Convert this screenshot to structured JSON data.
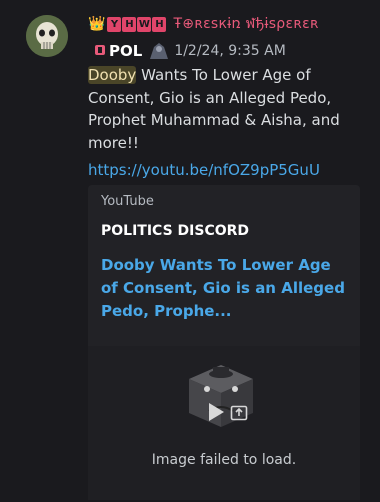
{
  "message": {
    "author": {
      "crown_icon": "crown-icon",
      "tag_letters": [
        "Y",
        "H",
        "W",
        "H"
      ],
      "tag_color": "#e0456a",
      "name": "Ŧ⊕ʀɛѕкɨռ ฬђɨѕρɛʀɛʀ",
      "name_color": "#e85a7a"
    },
    "role_tag": "POL",
    "timestamp": "1/2/24, 9:35 AM",
    "text": {
      "mention": "Dooby",
      "body": " Wants To Lower Age of Consent, Gio is an Alleged Pedo, Prophet Muhammad & Aisha, and more!!"
    },
    "link": "https://youtu.be/nfOZ9pP5GuU",
    "link_color": "#4aa8e8"
  },
  "embed": {
    "provider": "YouTube",
    "author": "POLITICS DISCORD",
    "title": "Dooby Wants To Lower Age of Consent, Gio is an Alleged Pedo, Prophe...",
    "thumbnail": {
      "status": "Image failed to load.",
      "play_icon": "play-icon",
      "external_icon": "open-external-icon"
    }
  }
}
